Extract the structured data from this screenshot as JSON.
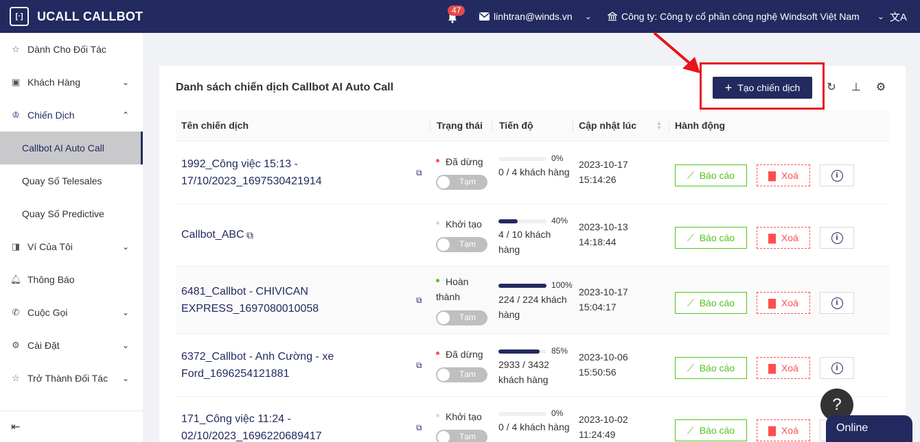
{
  "app": {
    "title": "UCALL CALLBOT",
    "logo_icon": "ucall-logo-icon"
  },
  "header": {
    "notifications": "47",
    "email": "linhtran@winds.vn",
    "company": "Công ty: Công ty cổ phần công nghệ Windsoft Việt Nam"
  },
  "sidebar": {
    "items": [
      {
        "label": "Dành Cho Đối Tác",
        "icon": "star-icon"
      },
      {
        "label": "Khách Hàng",
        "icon": "contact-icon"
      },
      {
        "label": "Chiến Dịch",
        "icon": "campaign-icon"
      },
      {
        "label": "Callbot AI Auto Call"
      },
      {
        "label": "Quay Số Telesales"
      },
      {
        "label": "Quay Số Predictive"
      },
      {
        "label": "Ví Của Tôi",
        "icon": "wallet-icon"
      },
      {
        "label": "Thông Báo",
        "icon": "bell-icon"
      },
      {
        "label": "Cuộc Gọi",
        "icon": "phone-icon"
      },
      {
        "label": "Cài Đặt",
        "icon": "gear-icon"
      },
      {
        "label": "Trở Thành Đối Tác",
        "icon": "star-icon"
      }
    ]
  },
  "main": {
    "title": "Danh sách chiến dịch Callbot AI Auto Call",
    "create_label": "Tạo chiến dịch",
    "columns": [
      "Tên chiến dịch",
      "Trạng thái",
      "Tiến độ",
      "Cập nhật lúc",
      "Hành động"
    ],
    "rows": [
      {
        "name": "1992_Công việc 15:13 - 17/10/2023_1697530421914",
        "status": "Đã dừng",
        "status_color": "#ff4d4f",
        "toggle": "Tạm",
        "progress": 0,
        "pct": "0%",
        "progress_text": "0 / 4 khách hàng",
        "date": "2023-10-17",
        "time": "15:14:26"
      },
      {
        "name": "Callbot_ABC",
        "status": "Khởi tạo",
        "status_color": "#d9d9d9",
        "toggle": "Tạm",
        "progress": 0.4,
        "pct": "40%",
        "progress_text": "4 / 10 khách hàng",
        "date": "2023-10-13",
        "time": "14:18:44"
      },
      {
        "name": "6481_Callbot - CHIVICAN EXPRESS_1697080010058",
        "status": "Hoàn thành",
        "status_color": "#52c41a",
        "toggle": "Tạm",
        "progress": 1.0,
        "pct": "100%",
        "progress_text": "224 / 224 khách hàng",
        "date": "2023-10-17",
        "time": "15:04:17"
      },
      {
        "name": "6372_Callbot - Anh Cường - xe Ford_1696254121881",
        "status": "Đã dừng",
        "status_color": "#ff4d4f",
        "toggle": "Tạm",
        "progress": 0.85,
        "pct": "85%",
        "progress_text": "2933 / 3432 khách hàng",
        "date": "2023-10-06",
        "time": "15:50:56"
      },
      {
        "name": "171_Công việc 11:24 - 02/10/2023_1696220689417",
        "status": "Khởi tạo",
        "status_color": "#d9d9d9",
        "toggle": "Tạm",
        "progress": 0,
        "pct": "0%",
        "progress_text": "0 / 4 khách hàng",
        "date": "2023-10-02",
        "time": "11:24:49"
      }
    ],
    "report_label": "Báo cáo",
    "delete_label": "Xoá"
  },
  "help": {
    "label": "?"
  },
  "online": {
    "label": "Online"
  },
  "colors": {
    "brand": "#222a5f",
    "highlight": "#e8141c"
  }
}
